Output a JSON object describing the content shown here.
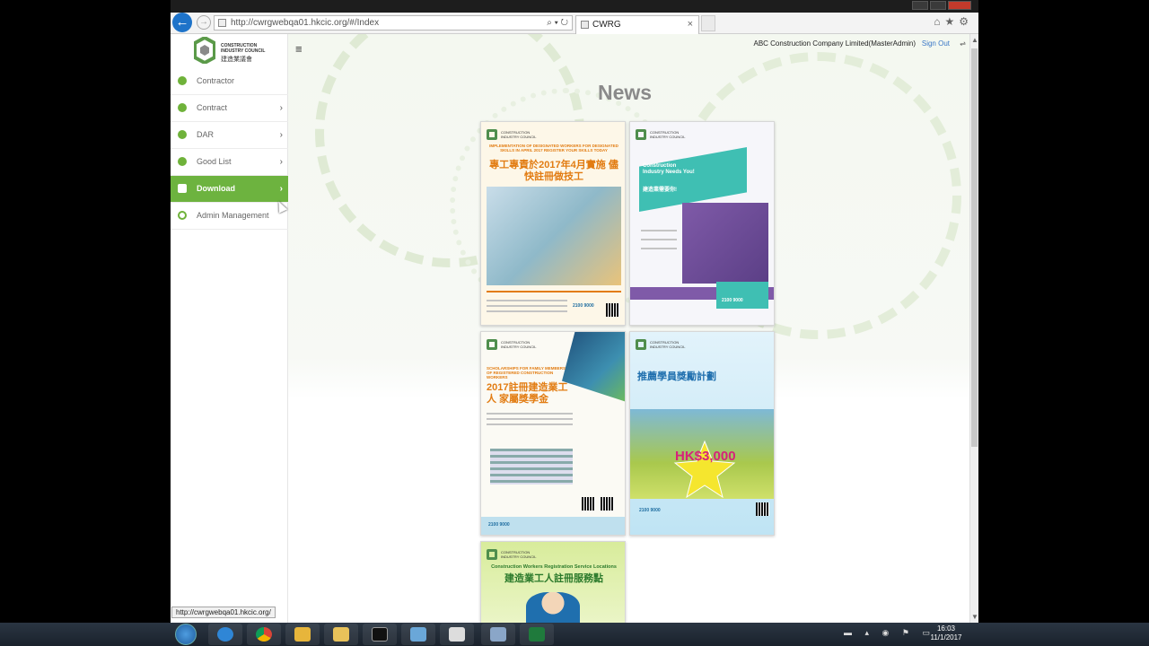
{
  "browser": {
    "url": "http://cwrgwebqa01.hkcic.org/#/Index",
    "tab_title": "CWRG",
    "tab_close": "×",
    "back_glyph": "←",
    "forward_glyph": "→",
    "addr_icons": "⌕ ▾ ↻",
    "right_icons": "⌂★⚙",
    "status_url": "http://cwrgwebqa01.hkcic.org/"
  },
  "logo": {
    "en": "CONSTRUCTION INDUSTRY COUNCIL",
    "zh": "建造業議會"
  },
  "sidebar": {
    "items": [
      {
        "label": "Contractor",
        "icon": "contractor-icon",
        "chevron": ""
      },
      {
        "label": "Contract",
        "icon": "contract-icon",
        "chevron": "›"
      },
      {
        "label": "DAR",
        "icon": "shield-icon",
        "chevron": "›"
      },
      {
        "label": "Good List",
        "icon": "list-icon",
        "chevron": "›"
      },
      {
        "label": "Download",
        "icon": "download-icon",
        "chevron": "›"
      },
      {
        "label": "Admin Management",
        "icon": "search-icon",
        "chevron": ""
      }
    ],
    "active_index": 4
  },
  "header": {
    "menu_glyph": "≡",
    "user": "ABC Construction Company Limited(MasterAdmin)",
    "sign_out": "Sign Out",
    "toggle_glyph": "⇌"
  },
  "main": {
    "title": "News",
    "posters": [
      {
        "heading": "IMPLEMENTATION OF DESIGNATED WORKERS FOR DESIGNATED SKILLS IN APRIL 2017 REGISTER YOUR SKILLS TODAY",
        "zh": "專工專責於2017年4月實施 儘快註冊做技工",
        "phone": "2100 9000"
      },
      {
        "heading": "Construction Industry Needs You!",
        "zh": "建造業需要你!",
        "phone": "2100 9000"
      },
      {
        "heading": "SCHOLARSHIPS FOR FAMILY MEMBERS OF REGISTERED CONSTRUCTION WORKERS",
        "zh": "2017註冊建造業工人 家屬獎學金",
        "phone": "2100 9000"
      },
      {
        "heading": "推薦學員獎勵計劃",
        "zh": "HK$3,000",
        "phone": "2100 9000"
      },
      {
        "heading": "Construction Workers Registration Service Locations",
        "zh": "建造業工人註冊服務點",
        "phone": ""
      }
    ]
  },
  "taskbar": {
    "time": "16:03",
    "date": "11/1/2017",
    "tray_icons": "▬ ▴ ◉ ⚑ ▭"
  },
  "colors": {
    "accent_green": "#6db33f",
    "link_blue": "#3a77c6"
  }
}
